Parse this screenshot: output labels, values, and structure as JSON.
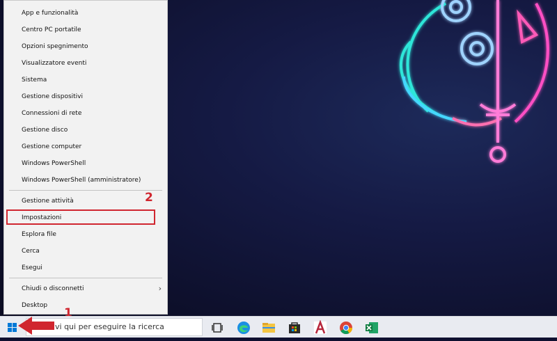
{
  "menu": {
    "items": [
      {
        "label": "App e funzionalità"
      },
      {
        "label": "Centro PC portatile"
      },
      {
        "label": "Opzioni spegnimento"
      },
      {
        "label": "Visualizzatore eventi"
      },
      {
        "label": "Sistema"
      },
      {
        "label": "Gestione dispositivi"
      },
      {
        "label": "Connessioni di rete"
      },
      {
        "label": "Gestione disco"
      },
      {
        "label": "Gestione computer"
      },
      {
        "label": "Windows PowerShell"
      },
      {
        "label": "Windows PowerShell (amministratore)"
      },
      {
        "label": "Gestione attività"
      },
      {
        "label": "Impostazioni"
      },
      {
        "label": "Esplora file"
      },
      {
        "label": "Cerca"
      },
      {
        "label": "Esegui"
      },
      {
        "label": "Chiudi o disconnetti"
      },
      {
        "label": "Desktop"
      }
    ]
  },
  "annotations": {
    "step1": "1",
    "step2": "2"
  },
  "taskbar": {
    "search_text": "vi qui per eseguire la ricerca",
    "icons": [
      "task-view-icon",
      "edge-icon",
      "file-explorer-icon",
      "store-icon",
      "access-icon",
      "chrome-icon",
      "excel-icon"
    ]
  },
  "colors": {
    "annotation_red": "#d0262f",
    "menu_bg": "#f2f2f2",
    "taskbar_bg": "#e9ebf1",
    "windows_blue": "#0078d7"
  }
}
